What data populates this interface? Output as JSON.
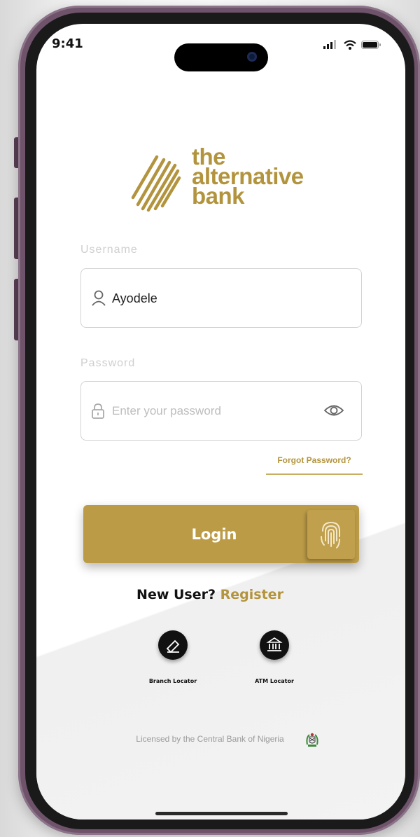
{
  "status_bar": {
    "time": "9:41"
  },
  "brand": {
    "line1": "the",
    "line2": "alternative",
    "line3": "bank",
    "color": "#b3943e"
  },
  "form": {
    "username_label": "Username",
    "username_value": "Ayodele",
    "password_label": "Password",
    "password_placeholder": "Enter your password",
    "forgot_password": "Forgot Password?",
    "login_label": "Login"
  },
  "register": {
    "prompt": "New User?",
    "link": "Register"
  },
  "locators": {
    "branch_label": "Branch Locator",
    "atm_label": "ATM Locator"
  },
  "footer": {
    "license_text": "Licensed by the Central Bank of Nigeria"
  },
  "icons": [
    "user-icon",
    "lock-icon",
    "eye-icon",
    "fingerprint-icon",
    "branch-locator-icon",
    "atm-locator-icon",
    "cbn-seal-icon"
  ]
}
